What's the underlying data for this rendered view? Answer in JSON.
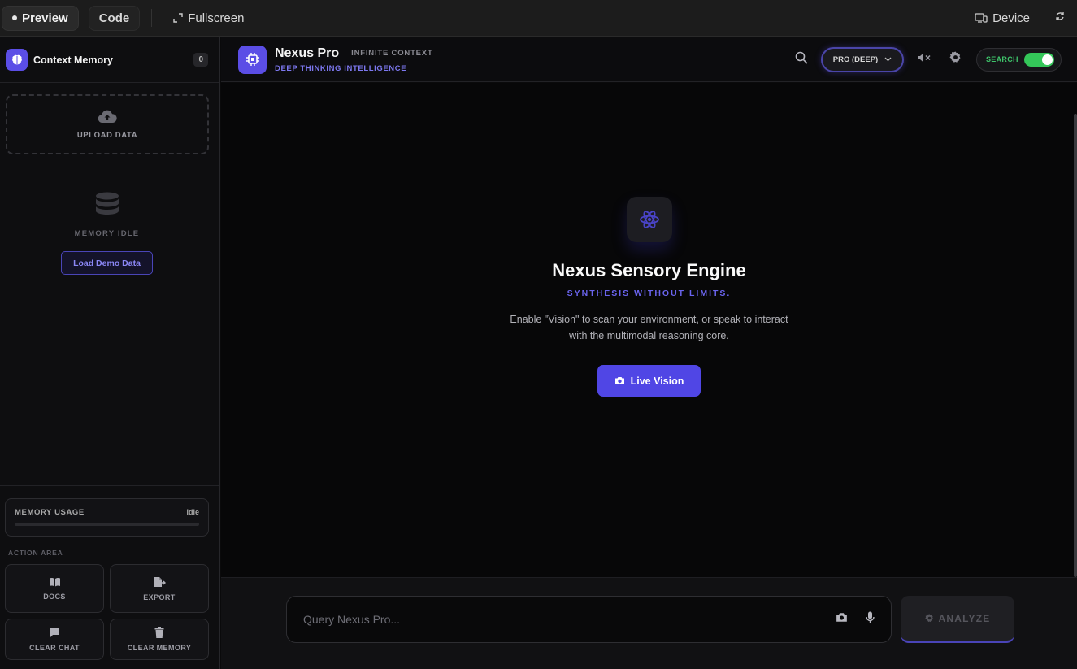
{
  "topbar": {
    "preview_label": "Preview",
    "code_label": "Code",
    "fullscreen_label": "Fullscreen",
    "device_label": "Device"
  },
  "sidebar": {
    "title": "Context Memory",
    "count": "0",
    "upload_label": "UPLOAD DATA",
    "idle_label": "MEMORY IDLE",
    "demo_button": "Load Demo Data",
    "memory_usage_label": "MEMORY USAGE",
    "memory_usage_status": "Idle",
    "action_area_label": "ACTION AREA",
    "actions": [
      {
        "label": "DOCS",
        "icon": "book-icon"
      },
      {
        "label": "EXPORT",
        "icon": "file-export-icon"
      },
      {
        "label": "CLEAR CHAT",
        "icon": "chat-icon"
      },
      {
        "label": "CLEAR MEMORY",
        "icon": "trash-icon"
      }
    ]
  },
  "header": {
    "brand": "Nexus Pro",
    "brand_sub": "INFINITE CONTEXT",
    "tagline": "DEEP THINKING INTELLIGENCE",
    "mode": "PRO (DEEP)",
    "search_toggle_label": "SEARCH",
    "search_enabled": true
  },
  "main": {
    "title": "Nexus Sensory Engine",
    "subtitle": "SYNTHESIS WITHOUT LIMITS.",
    "desc_line1": "Enable \"Vision\" to scan your environment, or speak to interact",
    "desc_line2": "with the multimodal reasoning core.",
    "vision_button": "Live Vision"
  },
  "footer": {
    "query_placeholder": "Query Nexus Pro...",
    "analyze_label": "ANALYZE"
  },
  "colors": {
    "accent": "#5b4ee6",
    "toggle_on": "#34c759",
    "background": "#070708"
  }
}
